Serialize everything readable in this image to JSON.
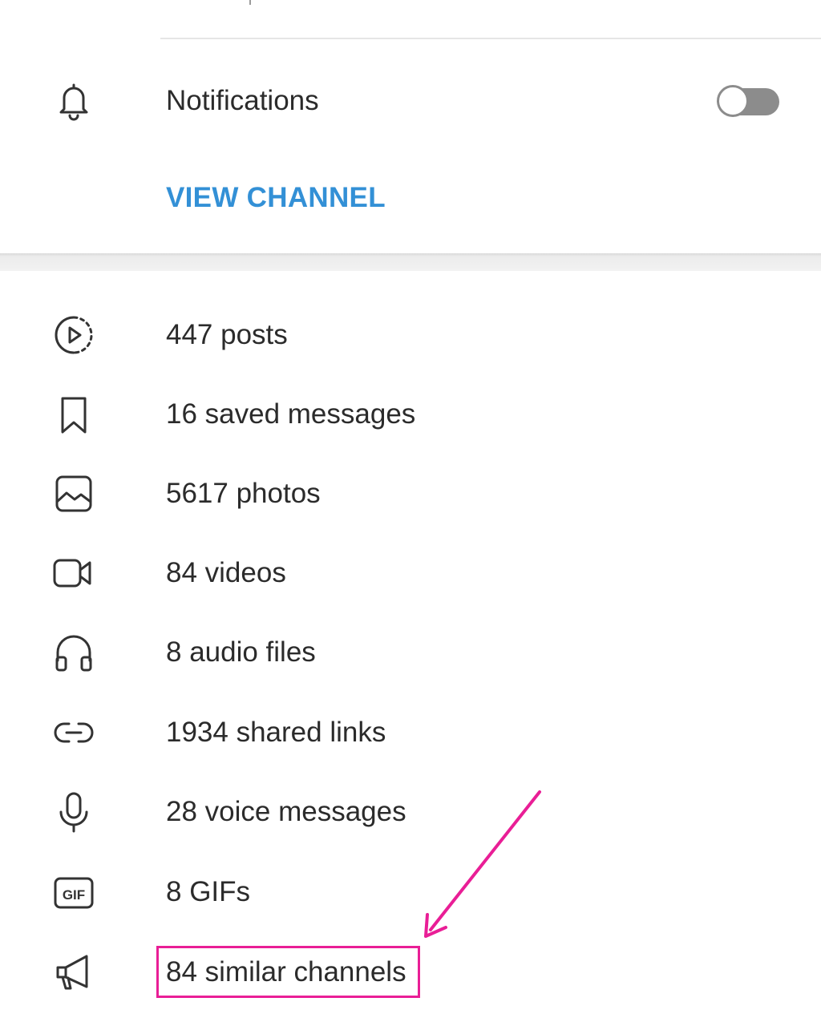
{
  "header": {
    "notifications_label": "Notifications",
    "notifications_enabled": false,
    "view_channel_label": "VIEW CHANNEL"
  },
  "media_list": [
    {
      "icon": "posts-icon",
      "label": "447 posts"
    },
    {
      "icon": "bookmark-icon",
      "label": "16 saved messages"
    },
    {
      "icon": "photo-icon",
      "label": "5617 photos"
    },
    {
      "icon": "video-icon",
      "label": "84 videos"
    },
    {
      "icon": "headphones-icon",
      "label": "8 audio files"
    },
    {
      "icon": "link-icon",
      "label": "1934 shared links"
    },
    {
      "icon": "microphone-icon",
      "label": "28 voice messages"
    },
    {
      "icon": "gif-icon",
      "label": "8 GIFs",
      "badge": "GIF"
    },
    {
      "icon": "megaphone-icon",
      "label": "84 similar channels"
    }
  ],
  "annotation": {
    "color": "#e91e96",
    "target": "84 similar channels"
  },
  "colors": {
    "accent": "#3390d6",
    "toggle_off": "#8c8c8c",
    "icon_stroke": "#333333",
    "annotation": "#e91e96"
  }
}
